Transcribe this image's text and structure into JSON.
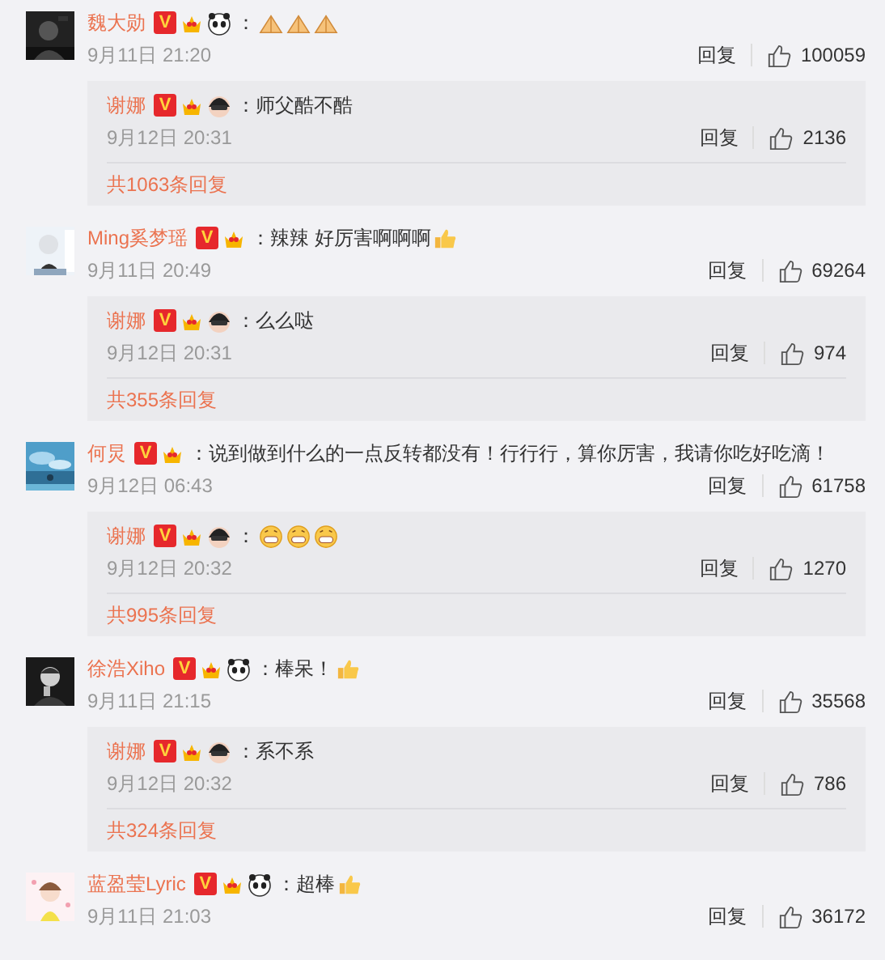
{
  "comments": [
    {
      "avatar": {
        "kind": "picture"
      },
      "name": "魏大勋",
      "badges": [
        {
          "kind": "verified",
          "label": "V"
        },
        {
          "kind": "crown"
        },
        {
          "kind": "panda"
        }
      ],
      "text": "：",
      "emojis": [
        {
          "kind": "hands"
        },
        {
          "kind": "hands"
        },
        {
          "kind": "hands"
        }
      ],
      "time": "9月11日 21:20",
      "reply_label": "回复",
      "likes": "100059",
      "reply": {
        "name": "谢娜",
        "badges": [
          {
            "kind": "verified",
            "label": "V"
          },
          {
            "kind": "crown"
          },
          {
            "kind": "masked"
          }
        ],
        "text": "：师父酷不酷",
        "time": "9月12日 20:31",
        "reply_label": "回复",
        "likes": "2136"
      },
      "more": "共1063条回复"
    },
    {
      "avatar": {
        "kind": "picture"
      },
      "name": "Ming奚梦瑶",
      "badges": [
        {
          "kind": "verified",
          "label": "V"
        },
        {
          "kind": "crown"
        }
      ],
      "text": "：辣辣 好厉害啊啊啊",
      "emojis": [
        {
          "kind": "thumbs"
        }
      ],
      "time": "9月11日 20:49",
      "reply_label": "回复",
      "likes": "69264",
      "reply": {
        "name": "谢娜",
        "badges": [
          {
            "kind": "verified",
            "label": "V"
          },
          {
            "kind": "crown"
          },
          {
            "kind": "masked"
          }
        ],
        "text": "：么么哒",
        "time": "9月12日 20:31",
        "reply_label": "回复",
        "likes": "974"
      },
      "more": "共355条回复"
    },
    {
      "avatar": {
        "kind": "picture"
      },
      "name": "何炅",
      "badges": [
        {
          "kind": "verified",
          "label": "V"
        },
        {
          "kind": "crown"
        }
      ],
      "text": "：说到做到什么的一点反转都没有！行行行，算你厉害，我请你吃好吃滴！",
      "time": "9月12日 06:43",
      "reply_label": "回复",
      "likes": "61758",
      "reply": {
        "name": "谢娜",
        "badges": [
          {
            "kind": "verified",
            "label": "V"
          },
          {
            "kind": "crown"
          },
          {
            "kind": "masked"
          }
        ],
        "text": "：",
        "emojis": [
          {
            "kind": "grin"
          },
          {
            "kind": "grin"
          },
          {
            "kind": "grin"
          }
        ],
        "time": "9月12日 20:32",
        "reply_label": "回复",
        "likes": "1270"
      },
      "more": "共995条回复"
    },
    {
      "avatar": {
        "kind": "picture"
      },
      "name": "徐浩Xiho",
      "badges": [
        {
          "kind": "verified",
          "label": "V"
        },
        {
          "kind": "crown"
        },
        {
          "kind": "panda"
        }
      ],
      "text": "：棒呆！",
      "emojis": [
        {
          "kind": "thumbs"
        }
      ],
      "time": "9月11日 21:15",
      "reply_label": "回复",
      "likes": "35568",
      "reply": {
        "name": "谢娜",
        "badges": [
          {
            "kind": "verified",
            "label": "V"
          },
          {
            "kind": "crown"
          },
          {
            "kind": "masked"
          }
        ],
        "text": "：系不系",
        "time": "9月12日 20:32",
        "reply_label": "回复",
        "likes": "786"
      },
      "more": "共324条回复"
    },
    {
      "avatar": {
        "kind": "picture"
      },
      "name": "蓝盈莹Lyric",
      "badges": [
        {
          "kind": "verified",
          "label": "V"
        },
        {
          "kind": "crown"
        },
        {
          "kind": "panda"
        }
      ],
      "text": "：超棒",
      "emojis": [
        {
          "kind": "thumbs"
        }
      ],
      "time": "9月11日 21:03",
      "reply_label": "回复",
      "likes": "36172"
    }
  ]
}
